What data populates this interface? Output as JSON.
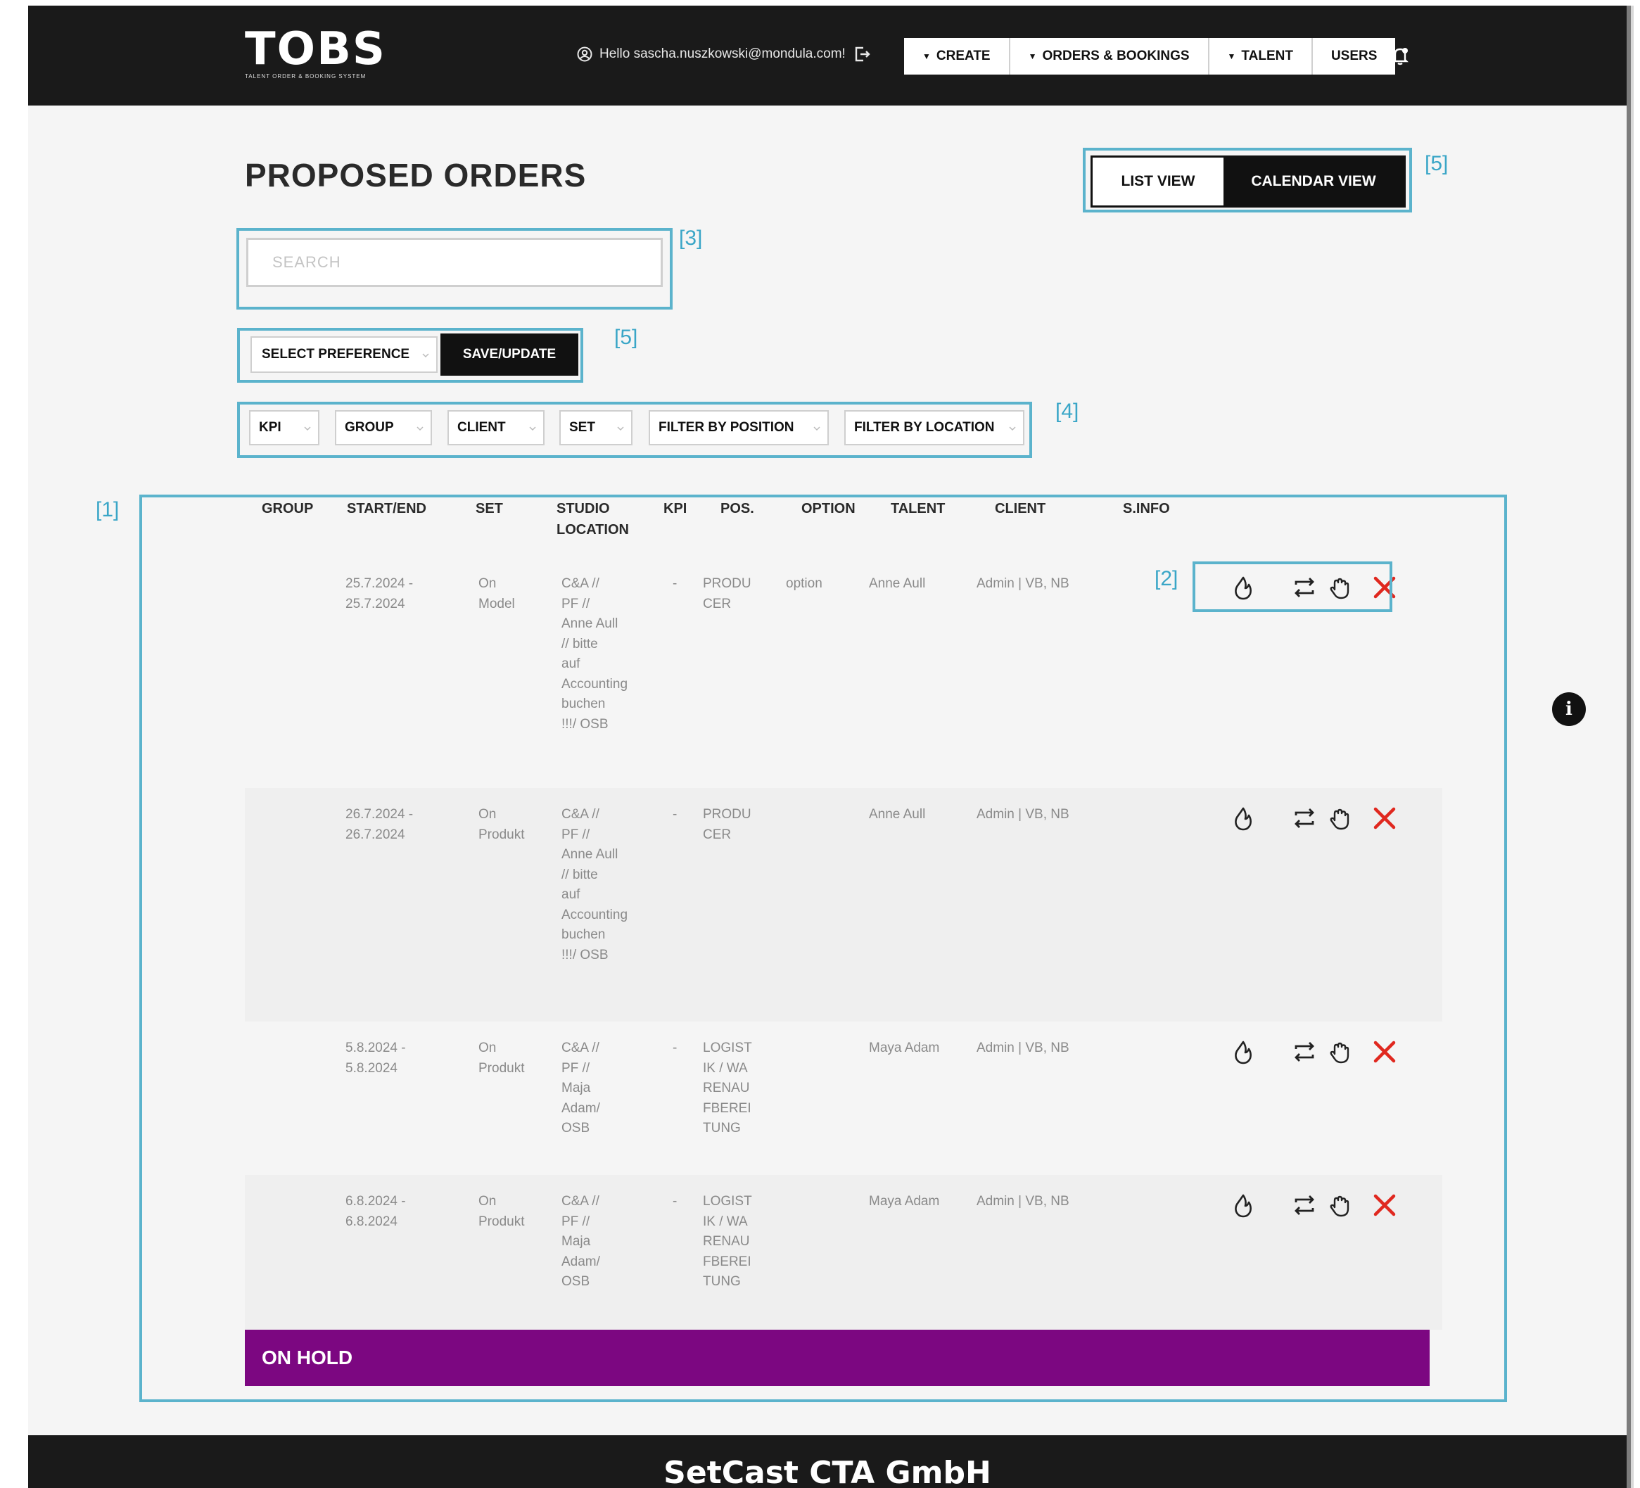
{
  "header": {
    "logo": "TOBS",
    "logo_tagline": "TALENT ORDER & BOOKING SYSTEM",
    "greeting": "Hello sascha.nuszkowski@mondula.com!",
    "nav": [
      {
        "label": "CREATE",
        "dropdown": true
      },
      {
        "label": "ORDERS & BOOKINGS",
        "dropdown": true
      },
      {
        "label": "TALENT",
        "dropdown": true
      },
      {
        "label": "USERS",
        "dropdown": false
      }
    ]
  },
  "page": {
    "title": "PROPOSED ORDERS",
    "view_toggle": {
      "list": "LIST VIEW",
      "calendar": "CALENDAR VIEW",
      "active": "calendar"
    },
    "search": {
      "placeholder": "SEARCH"
    },
    "preference": {
      "select_label": "SELECT PREFERENCE",
      "save_label": "SAVE/UPDATE"
    },
    "filters": [
      "KPI",
      "GROUP",
      "CLIENT",
      "SET",
      "FILTER BY POSITION",
      "FILTER BY LOCATION"
    ]
  },
  "annotations": {
    "table": "[1]",
    "actions": "[2]",
    "search": "[3]",
    "filters": "[4]",
    "preference": "[5]",
    "view_toggle": "[5]"
  },
  "table": {
    "columns": [
      "GROUP",
      "START/END",
      "SET",
      "STUDIO LOCATION",
      "KPI",
      "POS.",
      "OPTION",
      "TALENT",
      "CLIENT",
      "S.INFO"
    ],
    "rows": [
      {
        "group": "",
        "start_end": "25.7.2024 - 25.7.2024",
        "set": "On Model",
        "studio_location": "C&A // PF // Anne Aull // bitte auf Accounting buchen !!!/ OSB",
        "kpi": "-",
        "pos": "PRODUCER",
        "option": "option",
        "talent": "Anne Aull",
        "client": "Admin | VB, NB",
        "sinfo": ""
      },
      {
        "group": "",
        "start_end": "26.7.2024 - 26.7.2024",
        "set": "On Produkt",
        "studio_location": "C&A // PF // Anne Aull // bitte auf Accounting buchen !!!/ OSB",
        "kpi": "-",
        "pos": "PRODUCER",
        "option": "",
        "talent": "Anne Aull",
        "client": "Admin | VB, NB",
        "sinfo": ""
      },
      {
        "group": "",
        "start_end": "5.8.2024 - 5.8.2024",
        "set": "On Produkt",
        "studio_location": "C&A // PF // Maja Adam/ OSB",
        "kpi": "-",
        "pos": "LOGISTIK / WARENAUFBEREITUNG",
        "option": "",
        "talent": "Maya Adam",
        "client": "Admin | VB, NB",
        "sinfo": ""
      },
      {
        "group": "",
        "start_end": "6.8.2024 - 6.8.2024",
        "set": "On Produkt",
        "studio_location": "C&A // PF // Maja Adam/ OSB",
        "kpi": "-",
        "pos": "LOGISTIK / WARENAUFBEREITUNG",
        "option": "",
        "talent": "Maya Adam",
        "client": "Admin | VB, NB",
        "sinfo": ""
      }
    ],
    "actions": [
      "fire-icon",
      "swap-icon",
      "hand-icon",
      "close-icon"
    ],
    "section_label": "ON HOLD"
  },
  "colors": {
    "accent_annotation": "#5bb3cc",
    "on_hold": "#7c0781",
    "delete": "#e0281f"
  },
  "footer": {
    "company": "SetCast CTA GmbH"
  }
}
